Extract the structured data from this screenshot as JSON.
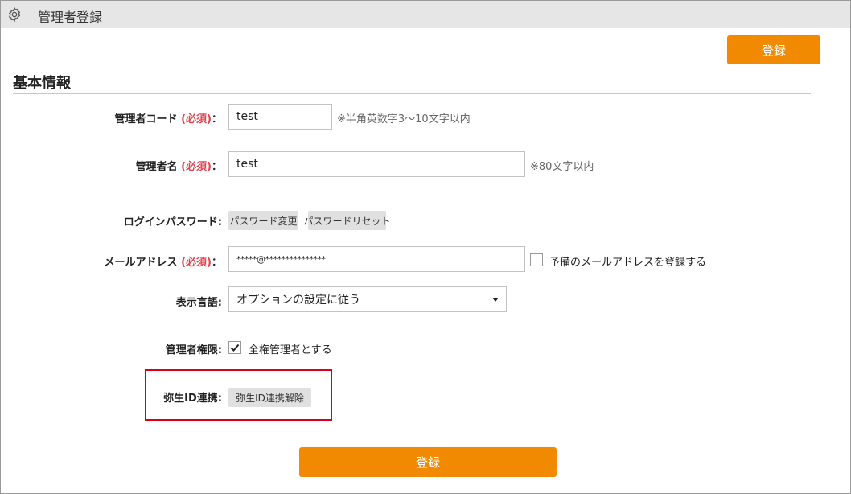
{
  "window": {
    "title": "管理者登録",
    "icon": "gear-icon"
  },
  "buttons": {
    "register_top": "登録",
    "register_bottom": "登録"
  },
  "section": {
    "title": "基本情報"
  },
  "fields": {
    "admin_code": {
      "label": "管理者コード",
      "required": "(必須)",
      "colon": "：",
      "value": "test",
      "hint": "※半角英数字3～10文字以内"
    },
    "admin_name": {
      "label": "管理者名",
      "required": "(必須)",
      "colon": "：",
      "value": "test",
      "hint": "※80文字以内"
    },
    "login_password": {
      "label": "ログインパスワード:",
      "change_button": "パスワード変更",
      "reset_button": "パスワードリセット"
    },
    "email": {
      "label": "メールアドレス",
      "required": "(必須)",
      "colon": "：",
      "value": "*****@***************",
      "spare_label": "予備のメールアドレスを登録する",
      "spare_checked": false
    },
    "language": {
      "label": "表示言語:",
      "selected": "オプションの設定に従う"
    },
    "admin_authority": {
      "label": "管理者権限:",
      "checkbox_label": "全権管理者とする",
      "checked": true
    },
    "yayoi_id": {
      "label": "弥生ID連携:",
      "unlink_button": "弥生ID連携解除"
    }
  },
  "colors": {
    "accent": "#f18a00",
    "required": "#e0454f",
    "highlight": "#d9001b",
    "titlebar": "#e6e6e6"
  }
}
